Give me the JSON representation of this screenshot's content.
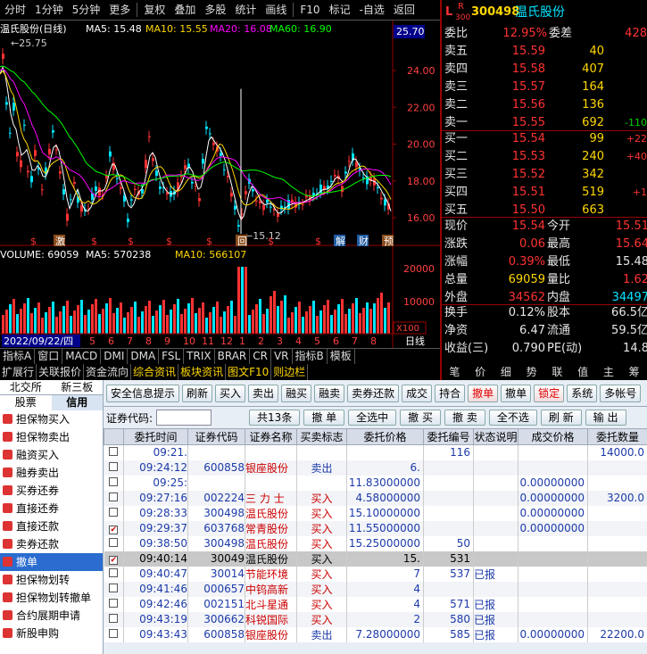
{
  "toolbar": {
    "items": [
      "分时",
      "1分钟",
      "5分钟",
      "更多",
      "复权",
      "叠加",
      "多股",
      "统计",
      "画线",
      "F10",
      "标记",
      "-自选",
      "返回"
    ]
  },
  "chart": {
    "title": "温氏股份(日线)",
    "ma5": "MA5: 15.48",
    "ma10": "MA10: 15.55",
    "ma20": "MA20: 16.08",
    "ma60": "MA60: 16.90",
    "high_label": "25.75",
    "low_label": "15.12",
    "price_box": "25.70",
    "y_ticks": [
      "24.00",
      "22.00",
      "20.00",
      "18.00",
      "16.00"
    ],
    "vol_title": "VOLUME: 69059",
    "vol_ma5": "MA5: 570238",
    "vol_ma10": "MA10: 566107",
    "vol_ticks": [
      "20000",
      "10000"
    ],
    "vol_unit": "X100",
    "date_label": "2022/09/22/四",
    "period": "日线",
    "event_marks": [
      "$",
      "激",
      "$",
      "$",
      "$",
      "$",
      "回",
      "$",
      "$",
      "解",
      "财",
      "预"
    ],
    "colors": {
      "up": "#ff3232",
      "down": "#00e5ff",
      "ma5": "#ffffff",
      "ma10": "#ffd700",
      "ma20": "#ff00ff",
      "ma60": "#00ff00"
    }
  },
  "chart_tabs": [
    "指标A",
    "窗口",
    "MACD",
    "DMI",
    "DMA",
    "FSL",
    "TRIX",
    "BRAR",
    "CR",
    "VR",
    "指标B",
    "模板"
  ],
  "func_tabs": [
    "扩展行",
    "关联报价",
    "资金流向",
    "综合资讯",
    "板块资讯",
    "图文F10",
    "则边栏"
  ],
  "quote": {
    "code": "300498",
    "name": "温氏股份",
    "mark": "L",
    "market": "R",
    "market_sub": "300",
    "wb_label": "委比",
    "wb": "12.95%",
    "wc_label": "委差",
    "wc": "428",
    "asks": [
      {
        "l": "卖五",
        "p": "15.59",
        "v": "40",
        "c": ""
      },
      {
        "l": "卖四",
        "p": "15.58",
        "v": "407",
        "c": ""
      },
      {
        "l": "卖三",
        "p": "15.57",
        "v": "164",
        "c": ""
      },
      {
        "l": "卖二",
        "p": "15.56",
        "v": "136",
        "c": ""
      },
      {
        "l": "卖一",
        "p": "15.55",
        "v": "692",
        "c": "-110"
      }
    ],
    "bids": [
      {
        "l": "买一",
        "p": "15.54",
        "v": "99",
        "c": "+22"
      },
      {
        "l": "买二",
        "p": "15.53",
        "v": "240",
        "c": "+40"
      },
      {
        "l": "买三",
        "p": "15.52",
        "v": "342",
        "c": ""
      },
      {
        "l": "买四",
        "p": "15.51",
        "v": "519",
        "c": "+1"
      },
      {
        "l": "买五",
        "p": "15.50",
        "v": "663",
        "c": ""
      }
    ],
    "stats": [
      {
        "a": "现价",
        "av": "15.54",
        "b": "今开",
        "bv": "15.51"
      },
      {
        "a": "涨跌",
        "av": "0.06",
        "b": "最高",
        "bv": "15.64"
      },
      {
        "a": "涨幅",
        "av": "0.39%",
        "b": "最低",
        "bv": "15.48"
      },
      {
        "a": "总量",
        "av": "69059",
        "b": "量比",
        "bv": "1.62"
      },
      {
        "a": "外盘",
        "av": "34562",
        "b": "内盘",
        "bv": "34497"
      }
    ],
    "stats2": [
      {
        "a": "换手",
        "av": "0.12%",
        "b": "股本",
        "bv": "66.5亿"
      },
      {
        "a": "净资",
        "av": "6.47",
        "b": "流通",
        "bv": "59.5亿"
      },
      {
        "a": "收益(三)",
        "av": "0.790",
        "b": "PE(动)",
        "bv": "14.8"
      }
    ]
  },
  "quote_tabs": [
    "笔",
    "价",
    "细",
    "势",
    "联",
    "值",
    "主",
    "筹"
  ],
  "nav": {
    "top": [
      "北交所",
      "新三板"
    ],
    "sub": [
      "股票",
      "信用"
    ],
    "items": [
      "担保物买入",
      "担保物卖出",
      "融资买入",
      "融券卖出",
      "买券还券",
      "直接还券",
      "直接还款",
      "卖券还款",
      "撤单",
      "担保物划转",
      "担保物划转撤单",
      "合约展期申请",
      "新股申购"
    ],
    "selected": 8
  },
  "buttons": [
    "安全信息提示",
    "刷新",
    "买入",
    "卖出",
    "融买",
    "融卖",
    "卖券还款",
    "成交",
    "持合",
    "撤单",
    "撤单",
    "锁定",
    "系统",
    "多帐号"
  ],
  "codebar": {
    "label": "证券代码:",
    "total": "共13条",
    "b1": "撤 单",
    "b2": "全选中",
    "b3": "撤 买",
    "b4": "撤 卖",
    "b5": "全不选",
    "b6": "刷 新",
    "b7": "输 出"
  },
  "table": {
    "headers": [
      "",
      "委托时间",
      "证券代码",
      "证券名称",
      "买卖标志",
      "委托价格",
      "委托编号",
      "状态说明",
      "成交价格",
      "委托数量"
    ],
    "rows": [
      {
        "chk": false,
        "time": "09:21.",
        "code": "",
        "name": "",
        "side": "",
        "price": "",
        "no": "116",
        "status": "",
        "deal": "",
        "qty": "14000.0"
      },
      {
        "chk": false,
        "time": "09:24:12",
        "code": "600858",
        "name": "银座股份",
        "side": "卖出",
        "price": "6.",
        "no": "",
        "status": "",
        "deal": "",
        "qty": ""
      },
      {
        "chk": false,
        "time": "09:25:",
        "code": "",
        "name": "",
        "side": "",
        "price": "11.83000000",
        "no": "",
        "status": "",
        "deal": "0.00000000",
        "qty": ""
      },
      {
        "chk": false,
        "time": "09:27:16",
        "code": "002224",
        "name": "三 力 士",
        "side": "买入",
        "price": "4.58000000",
        "no": "",
        "status": "",
        "deal": "0.00000000",
        "qty": "3200.0"
      },
      {
        "chk": false,
        "time": "09:28:33",
        "code": "300498",
        "name": "温氏股份",
        "side": "买入",
        "price": "15.10000000",
        "no": "",
        "status": "",
        "deal": "0.00000000",
        "qty": ""
      },
      {
        "chk": true,
        "time": "09:29:37",
        "code": "603768",
        "name": "常青股份",
        "side": "买入",
        "price": "11.55000000",
        "no": "",
        "status": "",
        "deal": "0.00000000",
        "qty": ""
      },
      {
        "chk": false,
        "time": "09:38:50",
        "code": "300498",
        "name": "温氏股份",
        "side": "买入",
        "price": "15.25000000",
        "no": "50",
        "status": "",
        "deal": "",
        "qty": ""
      },
      {
        "chk": true,
        "time": "09:40:14",
        "code": "30049",
        "name": "温氏股份",
        "side": "买入",
        "price": "15.",
        "no": "531",
        "status": "",
        "deal": "",
        "qty": ""
      },
      {
        "chk": false,
        "time": "09:40:47",
        "code": "30014",
        "name": "节能环境",
        "side": "买入",
        "price": "7",
        "no": "537",
        "status": "已报",
        "deal": "",
        "qty": ""
      },
      {
        "chk": false,
        "time": "09:41:46",
        "code": "000657",
        "name": "中钨高新",
        "side": "买入",
        "price": "4",
        "no": "",
        "status": "",
        "deal": "",
        "qty": ""
      },
      {
        "chk": false,
        "time": "09:42:46",
        "code": "002151",
        "name": "北斗星通",
        "side": "买入",
        "price": "4",
        "no": "571",
        "status": "已报",
        "deal": "",
        "qty": ""
      },
      {
        "chk": false,
        "time": "09:43:19",
        "code": "300662",
        "name": "科锐国际",
        "side": "买入",
        "price": "2",
        "no": "580",
        "status": "已报",
        "deal": "",
        "qty": ""
      },
      {
        "chk": false,
        "time": "09:43:43",
        "code": "600858",
        "name": "银座股份",
        "side": "卖出",
        "price": "7.28000000",
        "no": "585",
        "status": "已报",
        "deal": "0.00000000",
        "qty": "22200.0"
      }
    ],
    "selected_row": 7
  }
}
